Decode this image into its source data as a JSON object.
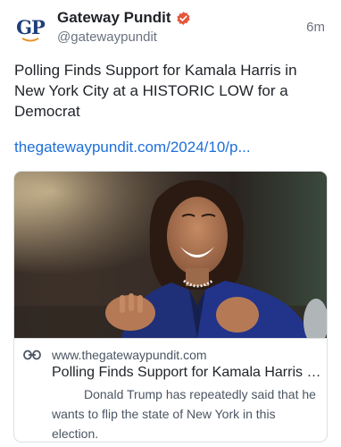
{
  "account": {
    "avatar_text": "GP",
    "display_name": "Gateway Pundit",
    "handle": "@gatewaypundit",
    "verified": true,
    "verified_icon": "verified-badge-icon",
    "verified_color": "#e4573d"
  },
  "post": {
    "time": "6m",
    "text": "Polling Finds Support for Kamala Harris in New York City at a HISTORIC LOW for a Democrat",
    "link_text": "thegatewaypundit.com/2024/10/p..."
  },
  "card": {
    "link_icon": "link-icon",
    "domain": "www.thegatewaypundit.com",
    "title": "Polling Finds Support for Kamala Harris in New York City at a HISTORIC LOW for a Democrat",
    "description": "Donald Trump has repeatedly said that he wants to flip the state of New York in this election."
  },
  "colors": {
    "brand_navy": "#1f3f7a",
    "brand_orange": "#e8932a",
    "link_blue": "#1e6fd9"
  }
}
